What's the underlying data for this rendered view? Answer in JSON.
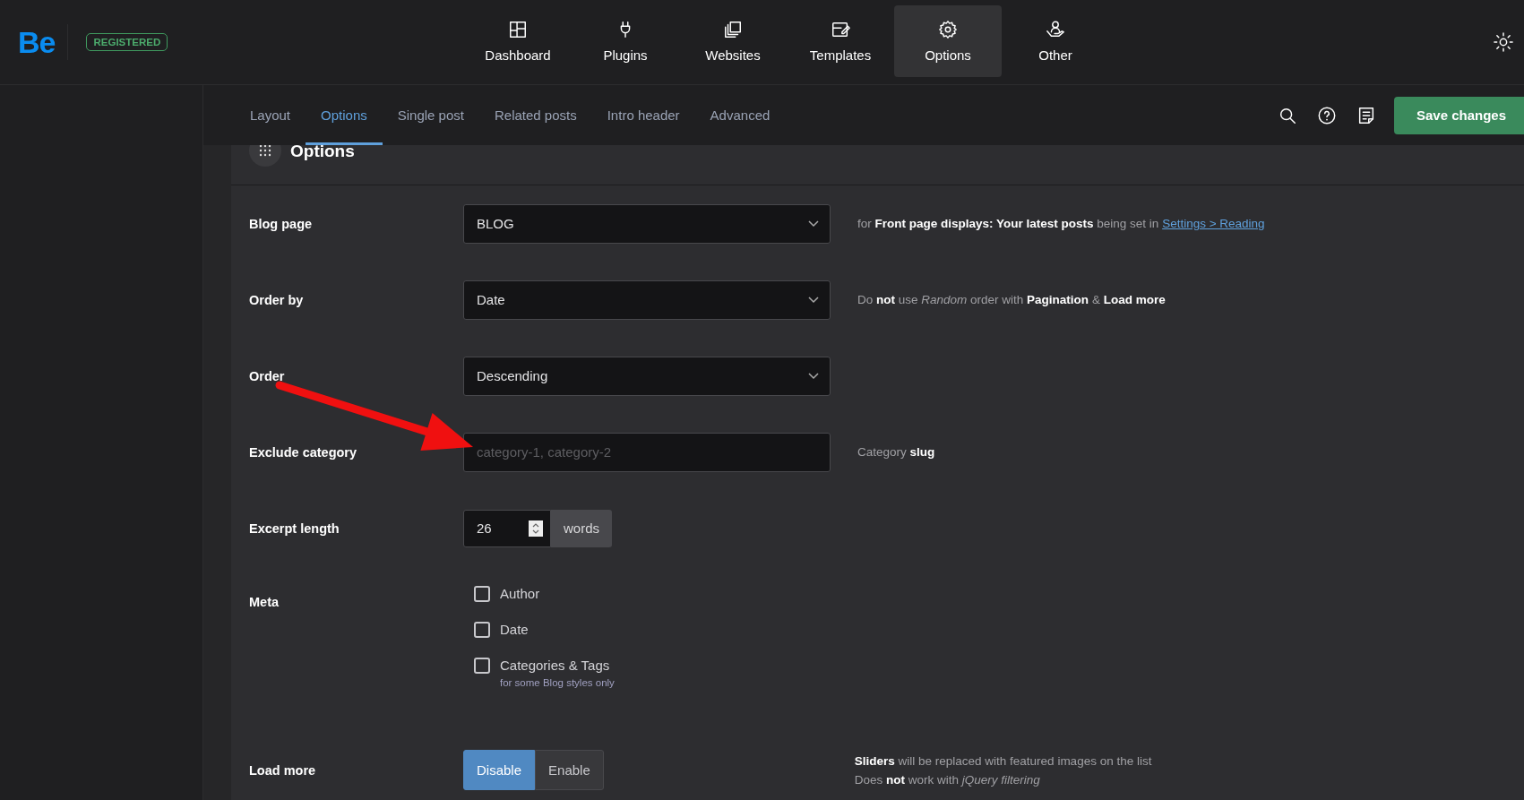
{
  "brand": {
    "logo": "Be",
    "badge": "REGISTERED"
  },
  "nav": [
    {
      "label": "Dashboard",
      "kind": "grid",
      "selected": false
    },
    {
      "label": "Plugins",
      "kind": "plug",
      "selected": false
    },
    {
      "label": "Websites",
      "kind": "copies",
      "selected": false
    },
    {
      "label": "Templates",
      "kind": "edit",
      "selected": false
    },
    {
      "label": "Options",
      "kind": "gear",
      "selected": true
    },
    {
      "label": "Other",
      "kind": "hand",
      "selected": false
    }
  ],
  "subtabs": [
    {
      "label": "Layout",
      "selected": false
    },
    {
      "label": "Options",
      "selected": true
    },
    {
      "label": "Single post",
      "selected": false
    },
    {
      "label": "Related posts",
      "selected": false
    },
    {
      "label": "Intro header",
      "selected": false
    },
    {
      "label": "Advanced",
      "selected": false
    }
  ],
  "save_button": "Save changes",
  "section": {
    "title": "Options"
  },
  "fields": [
    {
      "kind": "select",
      "label": "Blog page",
      "value": "BLOG",
      "hint": "for **Front page displays: Your latest posts** being set in",
      "hint_link": "Settings > Reading"
    },
    {
      "kind": "select",
      "label": "Order by",
      "value": "Date",
      "hint": "Do **not** use *Random* order with **Pagination** & **Load more**"
    },
    {
      "kind": "select",
      "label": "Order",
      "value": "Descending"
    },
    {
      "kind": "text",
      "label": "Exclude category",
      "placeholder": "category-1, category-2",
      "hint": "Category **slug**"
    },
    {
      "kind": "number",
      "label": "Excerpt length",
      "value": "26",
      "unit": "words"
    },
    {
      "kind": "checkboxes",
      "label": "Meta",
      "options": [
        {
          "label": "Author",
          "checked": false
        },
        {
          "label": "Date",
          "checked": false
        },
        {
          "label": "Categories & Tags",
          "note": "for some Blog styles only",
          "checked": false
        }
      ]
    },
    {
      "kind": "segmented",
      "label": "Load more",
      "options": [
        {
          "label": "Disable",
          "selected": true
        },
        {
          "label": "Enable",
          "selected": false
        }
      ],
      "hint_lines": [
        "**Sliders** will be replaced with featured images on the list",
        "Does **not** work with *jQuery filtering*"
      ]
    }
  ]
}
